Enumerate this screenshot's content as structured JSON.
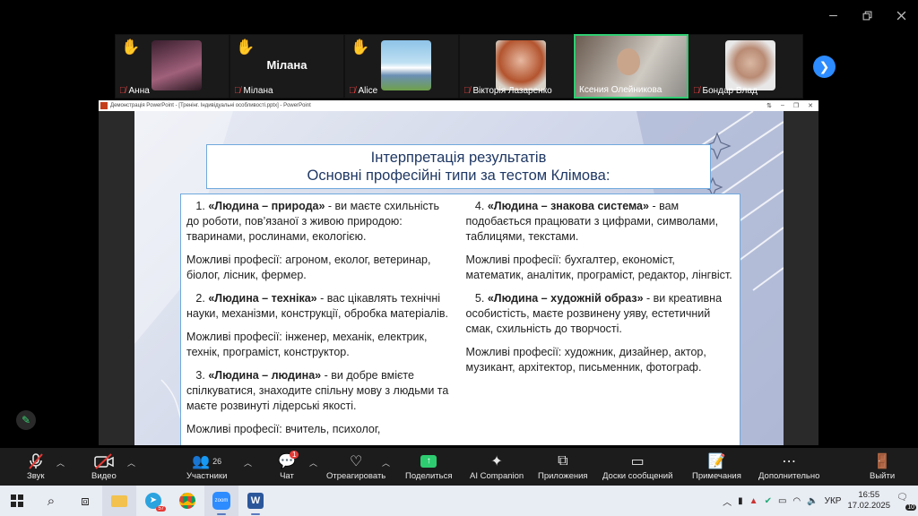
{
  "participants": [
    {
      "name": "Анна",
      "hand": true,
      "display": "photo"
    },
    {
      "name": "Мілана",
      "hand": true,
      "display": "name",
      "big_name": "Мілана"
    },
    {
      "name": "Alice",
      "hand": true,
      "display": "photo"
    },
    {
      "name": "Вікторія Лазаренко",
      "hand": false,
      "display": "photo"
    },
    {
      "name": "Ксения Олейникова",
      "hand": false,
      "display": "video",
      "active": true
    },
    {
      "name": "Бондар Влад",
      "hand": false,
      "display": "photo"
    }
  ],
  "ppt_window": {
    "title": "Демонстрація PowerPoint - [Тренінг. Індивідуальні особливості.pptx] - PowerPoint"
  },
  "slide": {
    "title_line1": "Інтерпретація результатів",
    "title_line2": "Основні професійні типи за тестом Клімова:",
    "left": [
      {
        "num": "1.",
        "head": "«Людина – природа»",
        "text": " - ви маєте схильність до роботи, пов’язаної з живою природою: тваринами, рослинами, екологією."
      },
      {
        "plain": "Можливі професії: агроном, еколог, ветеринар, біолог, лісник, фермер."
      },
      {
        "num": "2.",
        "head": "«Людина – техніка»",
        "text": " - вас цікавлять технічні науки, механізми, конструкції, обробка матеріалів."
      },
      {
        "plain": "Можливі професії: інженер, механік, електрик, технік, програміст, конструктор."
      },
      {
        "num": "3.",
        "head": "«Людина – людина»",
        "text": " - ви добре вмієте спілкуватися, знаходите спільну мову з людьми та маєте розвинуті лідерські якості."
      },
      {
        "plain": "Можливі професії: вчитель, психолог,"
      }
    ],
    "right": [
      {
        "num": "4.",
        "head": "«Людина – знакова система»",
        "text": " - вам подобається працювати з цифрами, символами, таблицями, текстами."
      },
      {
        "plain": "Можливі професії: бухгалтер, економіст, математик, аналітик, програміст, редактор, лінгвіст."
      },
      {
        "num": "5.",
        "head": "«Людина – художній образ»",
        "text": " - ви креативна особистість, маєте розвинену уяву, естетичний смак, схильність до творчості."
      },
      {
        "plain": "Можливі професії: художник, дизайнер, актор, музикант, архітектор, письменник, фотограф."
      }
    ]
  },
  "toolbar": {
    "audio": "Звук",
    "video": "Видео",
    "participants": "Участники",
    "participants_count": "26",
    "chat": "Чат",
    "chat_badge": "1",
    "react": "Отреагировать",
    "share": "Поделиться",
    "ai": "AI Companion",
    "apps": "Приложения",
    "boards": "Доски сообщений",
    "notes": "Примечания",
    "more": "Дополнительно",
    "leave": "Выйти"
  },
  "taskbar": {
    "telegram_badge": "57",
    "lang": "УКР",
    "time": "16:55",
    "date": "17.02.2025",
    "notif_count": "10"
  },
  "colors": {
    "active_border": "#2ecc71",
    "hand": "#f5c518",
    "mic_off": "#e04040",
    "accent": "#2d8cff",
    "leave": "#e53935"
  }
}
